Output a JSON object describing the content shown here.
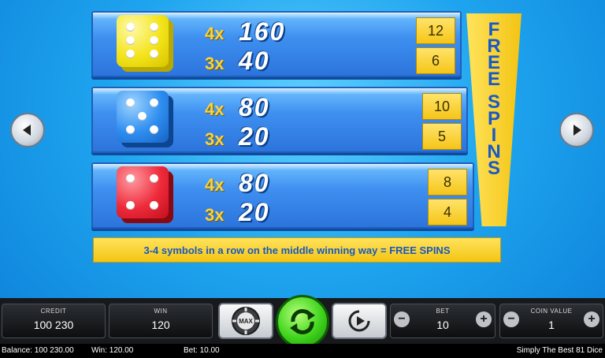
{
  "paytable": [
    {
      "color": "yellow",
      "rows": [
        {
          "mult": "4x",
          "payout": "160",
          "free_spins": "12"
        },
        {
          "mult": "3x",
          "payout": "40",
          "free_spins": "6"
        }
      ]
    },
    {
      "color": "blue",
      "rows": [
        {
          "mult": "4x",
          "payout": "80",
          "free_spins": "10"
        },
        {
          "mult": "3x",
          "payout": "20",
          "free_spins": "5"
        }
      ]
    },
    {
      "color": "red",
      "rows": [
        {
          "mult": "4x",
          "payout": "80",
          "free_spins": "8"
        },
        {
          "mult": "3x",
          "payout": "20",
          "free_spins": "4"
        }
      ]
    }
  ],
  "free_spins_banner": [
    "F",
    "R",
    "E",
    "E",
    "S",
    "P",
    "I",
    "N",
    "S"
  ],
  "info_text": "3-4 symbols in a row on the middle winning way = FREE SPINS",
  "nav": {
    "prev_icon": "triangle-left-icon",
    "next_icon": "triangle-right-icon"
  },
  "controls": {
    "credit": {
      "label": "CREDIT",
      "value": "100 230"
    },
    "win": {
      "label": "WIN",
      "value": "120"
    },
    "max_label": "MAX",
    "bet": {
      "label": "BET",
      "value": "10"
    },
    "coin_value": {
      "label": "COIN VALUE",
      "value": "1"
    },
    "minus_glyph": "−",
    "plus_glyph": "+"
  },
  "status": {
    "balance": "Balance: 100 230.00",
    "win": "Win: 120.00",
    "bet": "Bet: 10.00",
    "game_title": "Simply The Best 81 Dice"
  },
  "colors": {
    "background": "#1fa5ef",
    "accent_yellow": "#f3c413",
    "text_blue": "#1758c0",
    "spin_green": "#3fd41c"
  }
}
